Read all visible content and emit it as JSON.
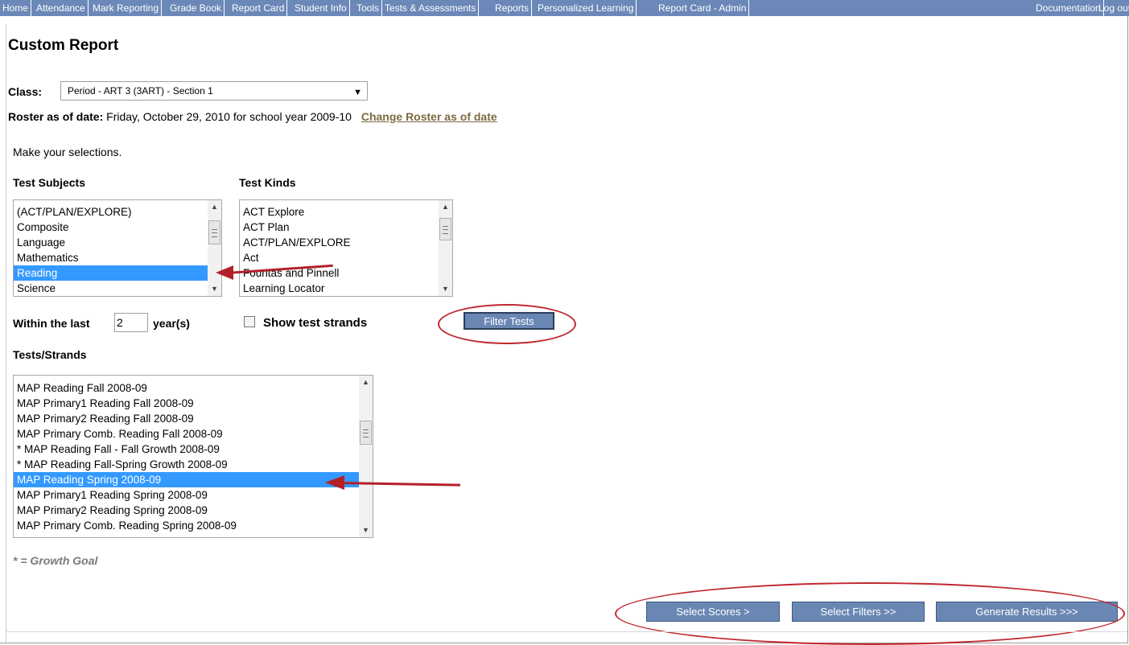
{
  "nav": {
    "items": [
      "Home",
      "Attendance",
      "Mark Reporting",
      "Grade Book",
      "Report Card",
      "Student Info",
      "Tools",
      "Tests & Assessments",
      "Reports",
      "Personalized Learning",
      "Report Card - Admin"
    ],
    "right_items": [
      "Documentation",
      "Log out"
    ]
  },
  "page_title": "Custom Report",
  "class_selector": {
    "label": "Class:",
    "value": "Period - ART 3 (3ART) - Section 1"
  },
  "roster": {
    "label": "Roster as of date:",
    "text": "Friday, October 29, 2010 for school year 2009-10",
    "link": "Change Roster as of date"
  },
  "instructions": "Make your selections.",
  "test_subjects": {
    "heading": "Test Subjects",
    "options": [
      "(ACT/PLAN/EXPLORE)",
      "Composite",
      "Language",
      "Mathematics",
      "Reading",
      "Science"
    ],
    "selected": "Reading"
  },
  "test_kinds": {
    "heading": "Test Kinds",
    "options": [
      "ACT Explore",
      "ACT Plan",
      "ACT/PLAN/EXPLORE",
      "Act",
      "Fountas and Pinnell",
      "Learning Locator"
    ]
  },
  "within": {
    "prefix": "Within the last",
    "value": "2",
    "suffix": "year(s)"
  },
  "show_strands": {
    "label": "Show test strands",
    "checked": false
  },
  "filter_button": "Filter Tests",
  "tests_strands": {
    "heading": "Tests/Strands",
    "options": [
      "MAP Reading Fall  2008-09",
      "MAP Primary1 Reading Fall  2008-09",
      "MAP Primary2 Reading Fall  2008-09",
      "MAP Primary Comb. Reading Fall  2008-09",
      "* MAP Reading Fall - Fall Growth 2008-09",
      "* MAP Reading Fall-Spring Growth 2008-09",
      "MAP Reading Spring  2008-09",
      "MAP Primary1 Reading Spring  2008-09",
      "MAP Primary2 Reading Spring  2008-09",
      "MAP Primary Comb. Reading Spring  2008-09"
    ],
    "selected": "MAP Reading Spring  2008-09"
  },
  "growth_note": "* = Growth Goal",
  "bottom_buttons": {
    "select_scores": "Select Scores >",
    "select_filters": "Select Filters >>",
    "generate_results": "Generate Results >>>"
  },
  "colors": {
    "nav_bg": "#6b88b8",
    "button_bg": "#6a87b3",
    "selection": "#3399ff",
    "annotation": "#c0272d"
  }
}
